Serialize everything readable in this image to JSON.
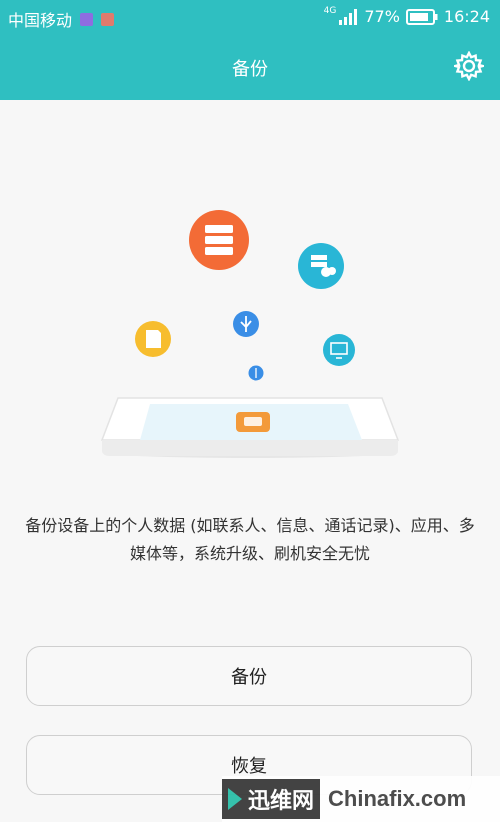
{
  "status_bar": {
    "carrier": "中国移动",
    "network": "4G",
    "battery": "77%",
    "time": "16:24"
  },
  "header": {
    "title": "备份",
    "settings_icon": "gear-icon"
  },
  "illustration": {
    "icons": [
      "server-icon",
      "cloud-server-icon",
      "sd-card-icon",
      "usb-icon",
      "computer-icon",
      "small-usb-icon",
      "phone-icon"
    ],
    "colors": {
      "orange": "#f36b36",
      "cyan": "#29b6d6",
      "yellow": "#f7bd2e",
      "blue": "#3a8ee6"
    }
  },
  "description": "备份设备上的个人数据 (如联系人、信息、通话记录)、应用、多媒体等，系统升级、刷机安全无忧",
  "buttons": {
    "backup": "备份",
    "restore": "恢复"
  },
  "watermark": {
    "left": "迅维网",
    "right": "Chinafix.com"
  },
  "theme": {
    "accent": "#2fbfc1",
    "background": "#f7f7f7"
  }
}
